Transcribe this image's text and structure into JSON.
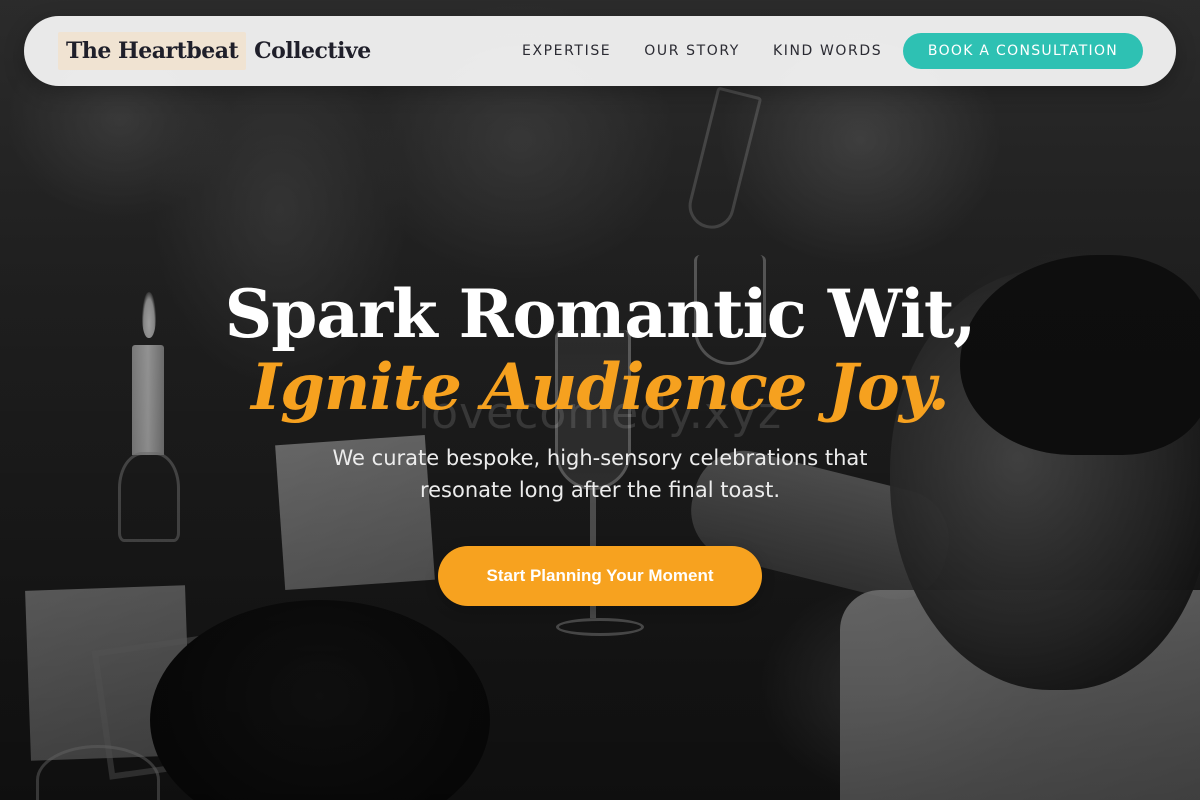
{
  "watermark": "lovecomedy.xyz",
  "navbar": {
    "brand_part1": "The Heartbeat",
    "brand_part2": "Collective",
    "links": [
      "EXPERTISE",
      "OUR STORY",
      "KIND WORDS"
    ],
    "cta_label": "BOOK A CONSULTATION",
    "cta_color": "#2ec1b3",
    "brand_highlight_color": "#f0e3d2"
  },
  "hero": {
    "title_line1": "Spark Romantic Wit,",
    "title_line2": "Ignite Audience Joy.",
    "subtitle": "We curate bespoke, high-sensory celebrations that resonate long after the final toast.",
    "cta_label": "Start Planning Your Moment",
    "accent_color": "#f6a11f",
    "cta_color": "#f7a21f"
  }
}
